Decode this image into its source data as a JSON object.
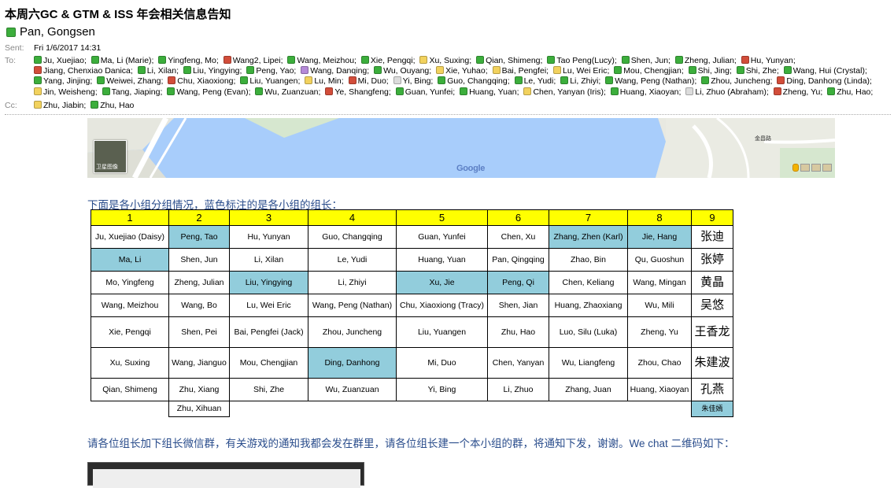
{
  "email": {
    "subject": "本周六GC & GTM & ISS 年会相关信息告知",
    "sender": {
      "name": "Pan, Gongsen",
      "status": "green"
    },
    "sent_label": "Sent:",
    "sent_value": "Fri 1/6/2017 14:31",
    "to_label": "To:",
    "cc_label": "Cc:",
    "to": [
      {
        "name": "Ju, Xuejiao;",
        "status": "green"
      },
      {
        "name": "Ma, Li (Marie);",
        "status": "green"
      },
      {
        "name": "Yingfeng, Mo;",
        "status": "green"
      },
      {
        "name": "Wang2, Lipei;",
        "status": "red"
      },
      {
        "name": "Wang, Meizhou;",
        "status": "green"
      },
      {
        "name": "Xie, Pengqi;",
        "status": "green"
      },
      {
        "name": "Xu, Suxing;",
        "status": "yellow"
      },
      {
        "name": "Qian, Shimeng;",
        "status": "green"
      },
      {
        "name": "Tao Peng(Lucy);",
        "status": "green"
      },
      {
        "name": "Shen, Jun;",
        "status": "green"
      },
      {
        "name": "Zheng, Julian;",
        "status": "green"
      },
      {
        "name": "Hu, Yunyan;",
        "status": "red"
      },
      {
        "name": "Jiang, Chenxiao Danica;",
        "status": "red"
      },
      {
        "name": "Li, Xilan;",
        "status": "green"
      },
      {
        "name": "Liu, Yingying;",
        "status": "green"
      },
      {
        "name": "Peng, Yao;",
        "status": "green"
      },
      {
        "name": "Wang, Danqing;",
        "status": "purple"
      },
      {
        "name": "Wu, Ouyang;",
        "status": "green"
      },
      {
        "name": "Xie, Yuhao;",
        "status": "yellow"
      },
      {
        "name": "Bai, Pengfei;",
        "status": "yellow"
      },
      {
        "name": "Lu, Wei Eric;",
        "status": "yellow"
      },
      {
        "name": "Mou, Chengjian;",
        "status": "green"
      },
      {
        "name": "Shi, Jing;",
        "status": "green"
      },
      {
        "name": "Shi, Zhe;",
        "status": "green"
      },
      {
        "name": "Wang, Hui (Crystal);",
        "status": "green"
      },
      {
        "name": "Yang, Jinjing;",
        "status": "green"
      },
      {
        "name": "Weiwei, Zhang;",
        "status": "green"
      },
      {
        "name": "Chu, Xiaoxiong;",
        "status": "red"
      },
      {
        "name": "Liu, Yuangen;",
        "status": "green"
      },
      {
        "name": "Lu, Min;",
        "status": "yellow"
      },
      {
        "name": "Mi, Duo;",
        "status": "red"
      },
      {
        "name": "Yi, Bing;",
        "status": "gray"
      },
      {
        "name": "Guo, Changqing;",
        "status": "green"
      },
      {
        "name": "Le, Yudi;",
        "status": "green"
      },
      {
        "name": "Li, Zhiyi;",
        "status": "green"
      },
      {
        "name": "Wang, Peng (Nathan);",
        "status": "green"
      },
      {
        "name": "Zhou, Juncheng;",
        "status": "green"
      },
      {
        "name": "Ding, Danhong (Linda);",
        "status": "red"
      },
      {
        "name": "Jin, Weisheng;",
        "status": "yellow"
      },
      {
        "name": "Tang, Jiaping;",
        "status": "green"
      },
      {
        "name": "Wang, Peng (Evan);",
        "status": "green"
      },
      {
        "name": "Wu, Zuanzuan;",
        "status": "green"
      },
      {
        "name": "Ye, Shangfeng;",
        "status": "red"
      },
      {
        "name": "Guan, Yunfei;",
        "status": "green"
      },
      {
        "name": "Huang, Yuan;",
        "status": "green"
      },
      {
        "name": "Chen, Yanyan (Iris);",
        "status": "yellow"
      },
      {
        "name": "Huang, Xiaoyan;",
        "status": "green"
      },
      {
        "name": "Li, Zhuo (Abraham);",
        "status": "gray"
      },
      {
        "name": "Zheng, Yu;",
        "status": "red"
      },
      {
        "name": "Zhu, Hao;",
        "status": "green"
      }
    ],
    "cc": [
      {
        "name": "Zhu, Jiabin;",
        "status": "yellow"
      },
      {
        "name": "Zhu, Hao",
        "status": "green"
      }
    ]
  },
  "map": {
    "google_label": "Google",
    "satellite_label": "卫星图像",
    "place_label": "金昌路"
  },
  "intro_text": "下面是各小组分组情况，蓝色标注的是各小组的组长：",
  "groups_table": {
    "headers": [
      "1",
      "2",
      "3",
      "4",
      "5",
      "6",
      "7",
      "8",
      "9"
    ],
    "rows": [
      [
        "Ju, Xuejiao (Daisy)",
        "Peng, Tao",
        "Hu, Yunyan",
        "Guo, Changqing",
        "Guan, Yunfei",
        "Chen, Xu",
        "Zhang, Zhen (Karl)",
        "Jie, Hang",
        "张迪"
      ],
      [
        "Ma, Li",
        "Shen, Jun",
        "Li, Xilan",
        "Le, Yudi",
        "Huang, Yuan",
        "Pan, Qingqing",
        "Zhao, Bin",
        "Qu, Guoshun",
        "张婷"
      ],
      [
        "Mo, Yingfeng",
        "Zheng, Julian",
        "Liu, Yingying",
        "Li, Zhiyi",
        "Xu, Jie",
        "Peng, Qi",
        "Chen, Keliang",
        "Wang, Mingan",
        "黄晶"
      ],
      [
        "Wang, Meizhou",
        "Wang, Bo",
        "Lu, Wei Eric",
        "Wang, Peng (Nathan)",
        "Chu, Xiaoxiong (Tracy)",
        "Shen, Jian",
        "Huang, Zhaoxiang",
        "Wu, Mili",
        "吴悠"
      ],
      [
        "Xie, Pengqi",
        "Shen, Pei",
        "Bai, Pengfei (Jack)",
        "Zhou, Juncheng",
        "Liu, Yuangen",
        "Zhu, Hao",
        "Luo, Silu (Luka)",
        "Zheng, Yu",
        "王香龙"
      ],
      [
        "Xu, Suxing",
        "Wang, Jianguo",
        "Mou, Chengjian",
        "Ding, Danhong",
        "Mi, Duo",
        "Chen, Yanyan",
        "Wu, Liangfeng",
        "Zhou, Chao",
        "朱建波"
      ],
      [
        "Qian, Shimeng",
        "Zhu, Xiang",
        "Shi, Zhe",
        "Wu, Zuanzuan",
        "Yi, Bing",
        "Li, Zhuo",
        "Zhang, Juan",
        "Huang, Xiaoyan",
        "孔燕"
      ],
      [
        "",
        "Zhu, Xihuan",
        "",
        "",
        "",
        "",
        "",
        "",
        "朱佳嫣"
      ]
    ],
    "leaders": [
      [
        0,
        1
      ],
      [
        0,
        6
      ],
      [
        0,
        7
      ],
      [
        1,
        0
      ],
      [
        2,
        2
      ],
      [
        2,
        4
      ],
      [
        2,
        5
      ],
      [
        5,
        3
      ],
      [
        7,
        8
      ]
    ],
    "leader_color": "#92cddc",
    "header_color": "#ffff00"
  },
  "outro_text": "请各位组长加下组长微信群，有关游戏的通知我都会发在群里，请各位组长建一个本小组的群，将通知下发，谢谢。We chat 二维码如下：",
  "status_colors": {
    "green": "#3cae3c",
    "red": "#d24d3a",
    "yellow": "#f2d25e",
    "gray": "#dcdcdc",
    "purple": "#b48ad8"
  },
  "text_colors": {
    "body_blue": "#2a4d8c"
  }
}
